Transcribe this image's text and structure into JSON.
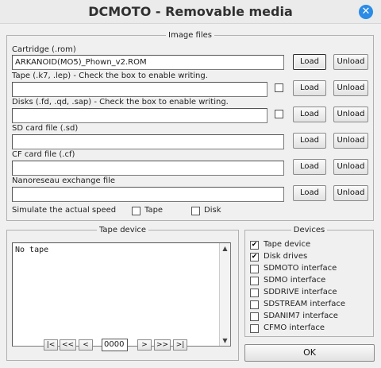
{
  "window": {
    "title": "DCMOTO  - Removable media",
    "close_glyph": "✕"
  },
  "image_files": {
    "legend": "Image files",
    "cartridge": {
      "label": "Cartridge (.rom)",
      "value": "ARKANOID(MO5)_Phown_v2.ROM",
      "load": "Load",
      "unload": "Unload"
    },
    "tape": {
      "label": "Tape (.k7, .lep) - Check the box to enable writing.",
      "value": "",
      "writable": false,
      "load": "Load",
      "unload": "Unload"
    },
    "disks": {
      "label": "Disks (.fd, .qd, .sap) - Check the box to enable writing.",
      "value": "",
      "writable": false,
      "load": "Load",
      "unload": "Unload"
    },
    "sd": {
      "label": "SD card file (.sd)",
      "value": "",
      "load": "Load",
      "unload": "Unload"
    },
    "cf": {
      "label": "CF card file (.cf)",
      "value": "",
      "load": "Load",
      "unload": "Unload"
    },
    "nano": {
      "label": "Nanoreseau exchange file",
      "value": "",
      "load": "Load",
      "unload": "Unload"
    },
    "speed": {
      "label": "Simulate the actual speed",
      "tape_label": "Tape",
      "tape_checked": false,
      "disk_label": "Disk",
      "disk_checked": false
    }
  },
  "tape_device": {
    "legend": "Tape device",
    "content": "No tape",
    "nav": {
      "first": "|<",
      "prev_fast": "<<",
      "prev": "<",
      "counter": "0000",
      "next": ">",
      "next_fast": ">>",
      "last": ">|"
    }
  },
  "devices": {
    "legend": "Devices",
    "items": [
      {
        "label": "Tape device",
        "checked": true
      },
      {
        "label": "Disk drives",
        "checked": true
      },
      {
        "label": "SDMOTO interface",
        "checked": false
      },
      {
        "label": "SDMO interface",
        "checked": false
      },
      {
        "label": "SDDRIVE interface",
        "checked": false
      },
      {
        "label": "SDSTREAM interface",
        "checked": false
      },
      {
        "label": "SDANIM7 interface",
        "checked": false
      },
      {
        "label": "CFMO interface",
        "checked": false
      }
    ]
  },
  "ok_button": "OK",
  "check_glyph": "✔"
}
